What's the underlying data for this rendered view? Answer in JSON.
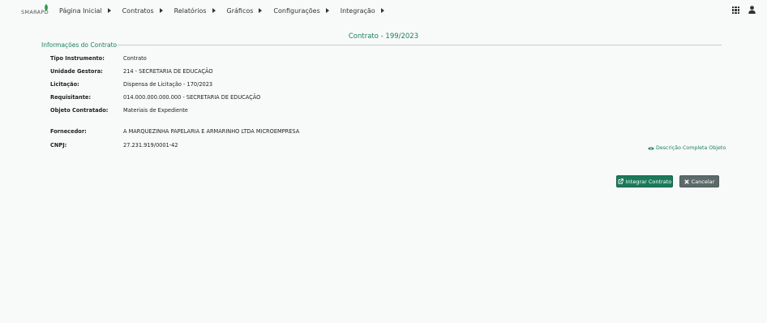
{
  "app": {
    "logo_text": "SMARAPD"
  },
  "nav": {
    "items": [
      {
        "label": "Página Inicial"
      },
      {
        "label": "Contratos"
      },
      {
        "label": "Relatórios"
      },
      {
        "label": "Gráficos"
      },
      {
        "label": "Configurações"
      },
      {
        "label": "Integração"
      }
    ]
  },
  "header": {
    "section_title": "Informações do Contrato",
    "contract_title": "Contrato - 199/2023"
  },
  "details": [
    {
      "label": "Tipo Instrumento:",
      "value": "Contrato"
    },
    {
      "label": "Unidade Gestora:",
      "value": "214 - SECRETARIA DE EDUCAÇÃO"
    },
    {
      "label": "Licitação:",
      "value": "Dispensa de Licitação - 170/2023"
    },
    {
      "label": "Requisitante:",
      "value": "014.000.000.000.000 - SECRETARIA DE EDUCAÇÃO"
    },
    {
      "label": "Objeto Contratado:",
      "value": "Materiais de Expediente"
    },
    {
      "label": "Fornecedor:",
      "value": "A MARQUEZINHA PAPELARIA E ARMARINHO LTDA MICROEMPRESA"
    },
    {
      "label": "CNPJ:",
      "value": "27.231.919/0001-42"
    }
  ],
  "actions": {
    "desc_link": "Descrição Completa Objeto",
    "integrar_label": "Integrar Contrato",
    "cancelar_label": "Cancelar"
  },
  "colors": {
    "accent": "#1b7f63",
    "button_primary": "#1b7a5a",
    "button_secondary": "#5b6b69"
  },
  "icons": [
    "apps-grid-icon",
    "user-icon",
    "eye-icon",
    "external-link-icon",
    "close-icon",
    "caret-right-icon"
  ]
}
